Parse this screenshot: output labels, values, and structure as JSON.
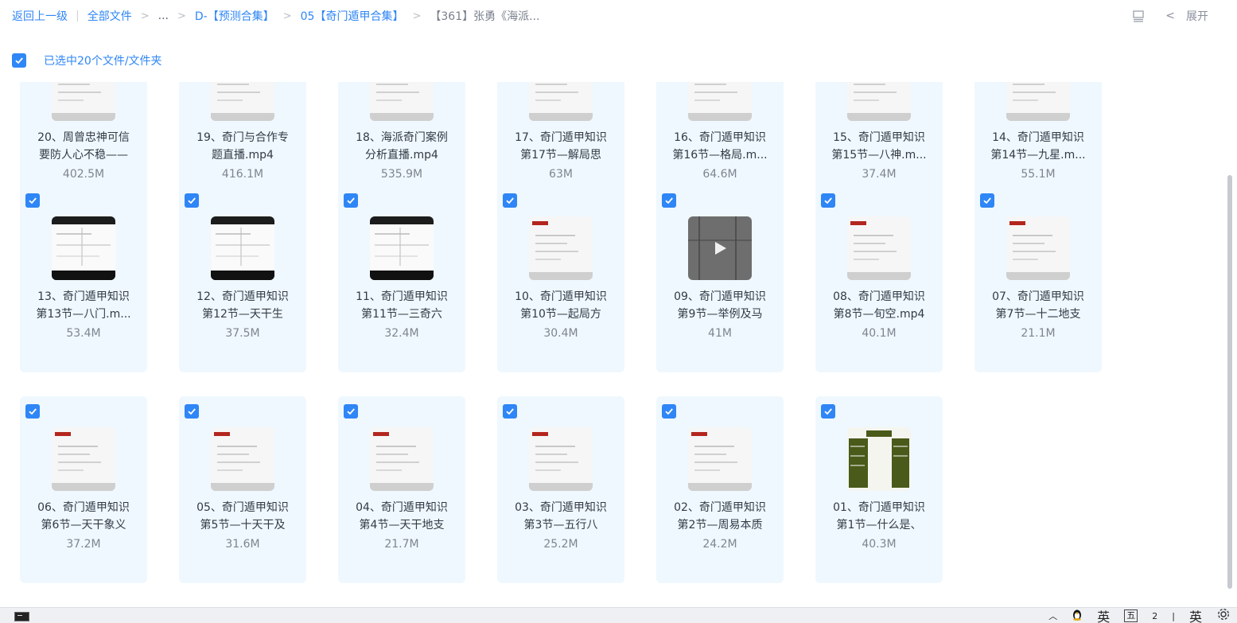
{
  "breadcrumb": {
    "back": "返回上一级",
    "all_files": "全部文件",
    "ellipsis": "...",
    "level1": "D-【预测合集】",
    "level2": "05【奇门遁甲合集】",
    "current": "【361】张勇《海派..."
  },
  "toolbar": {
    "expand_label": "展开"
  },
  "selection": {
    "label": "已选中20个文件/文件夹",
    "checked": true
  },
  "files": [
    {
      "line1": "20、周曾忠神可信",
      "line2": "要防人心不稳——",
      "size": "402.5M"
    },
    {
      "line1": "19、奇门与合作专",
      "line2": "题直播.mp4",
      "size": "416.1M"
    },
    {
      "line1": "18、海派奇门案例",
      "line2": "分析直播.mp4",
      "size": "535.9M"
    },
    {
      "line1": "17、奇门遁甲知识",
      "line2": "第17节—解局思",
      "size": "63M"
    },
    {
      "line1": "16、奇门遁甲知识",
      "line2": "第16节—格局.m...",
      "size": "64.6M"
    },
    {
      "line1": "15、奇门遁甲知识",
      "line2": "第15节—八神.m...",
      "size": "37.4M"
    },
    {
      "line1": "14、奇门遁甲知识",
      "line2": "第14节—九星.m...",
      "size": "55.1M"
    },
    {
      "line1": "13、奇门遁甲知识",
      "line2": "第13节—八门.m...",
      "size": "53.4M"
    },
    {
      "line1": "12、奇门遁甲知识",
      "line2": "第12节—天干生",
      "size": "37.5M"
    },
    {
      "line1": "11、奇门遁甲知识",
      "line2": "第11节—三奇六",
      "size": "32.4M"
    },
    {
      "line1": "10、奇门遁甲知识",
      "line2": "第10节—起局方",
      "size": "30.4M"
    },
    {
      "line1": "09、奇门遁甲知识",
      "line2": "第9节—举例及马",
      "size": "41M"
    },
    {
      "line1": "08、奇门遁甲知识",
      "line2": "第8节—旬空.mp4",
      "size": "40.1M"
    },
    {
      "line1": "07、奇门遁甲知识",
      "line2": "第7节—十二地支",
      "size": "21.1M"
    },
    {
      "line1": "06、奇门遁甲知识",
      "line2": "第6节—天干象义",
      "size": "37.2M"
    },
    {
      "line1": "05、奇门遁甲知识",
      "line2": "第5节—十天干及",
      "size": "31.6M"
    },
    {
      "line1": "04、奇门遁甲知识",
      "line2": "第4节—天干地支",
      "size": "21.7M"
    },
    {
      "line1": "03、奇门遁甲知识",
      "line2": "第3节—五行八",
      "size": "25.2M"
    },
    {
      "line1": "02、奇门遁甲知识",
      "line2": "第2节—周易本质",
      "size": "24.2M"
    },
    {
      "line1": "01、奇门遁甲知识",
      "line2": "第1节—什么是、",
      "size": "40.3M"
    }
  ],
  "taskbar": {
    "ime_lang": "英",
    "ime_mode": "五",
    "ime_num": "2",
    "ime_lang2": "英"
  },
  "colors": {
    "accent": "#2f86f6",
    "card_bg": "#eff8fe"
  }
}
